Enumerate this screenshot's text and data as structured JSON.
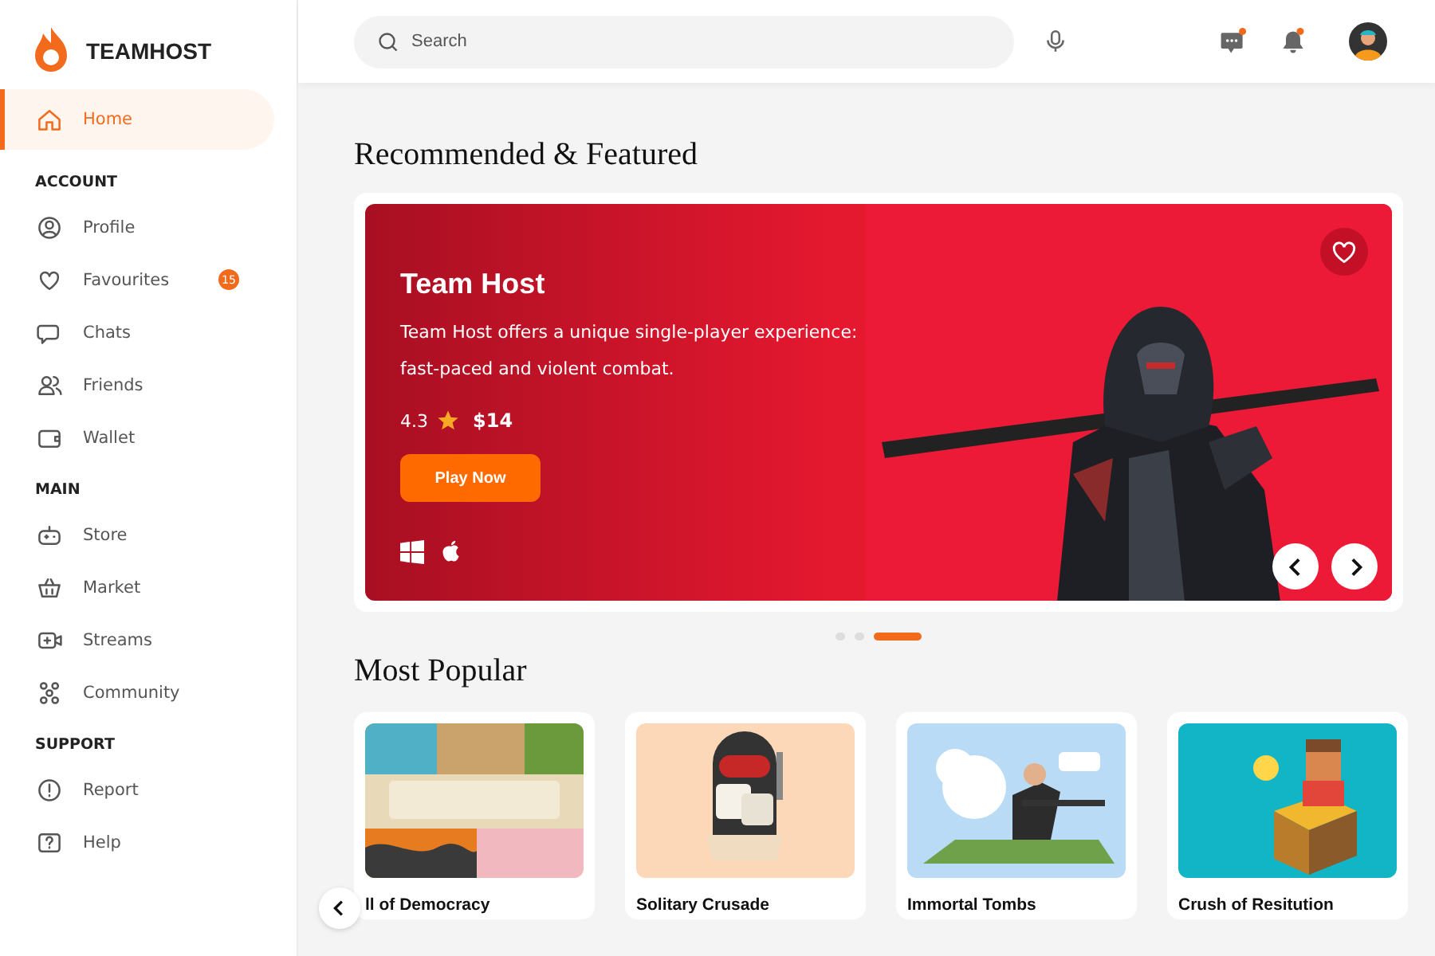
{
  "brand": {
    "name": "TEAMHOST"
  },
  "sidebar": {
    "sections": [
      {
        "items": [
          {
            "label": "Home",
            "selected": true
          }
        ]
      },
      {
        "heading": "ACCOUNT",
        "items": [
          {
            "label": "Profile",
            "selected": false
          },
          {
            "label": "Favourites",
            "selected": false,
            "badge": "15"
          },
          {
            "label": "Chats",
            "selected": false
          },
          {
            "label": "Friends",
            "selected": false
          },
          {
            "label": "Wallet",
            "selected": false
          }
        ]
      },
      {
        "heading": "MAIN",
        "items": [
          {
            "label": "Store",
            "selected": false
          },
          {
            "label": "Market",
            "selected": false
          },
          {
            "label": "Streams",
            "selected": false
          },
          {
            "label": "Community",
            "selected": false
          }
        ]
      },
      {
        "heading": "SUPPORT",
        "items": [
          {
            "label": "Report",
            "selected": false
          },
          {
            "label": "Help",
            "selected": false
          }
        ]
      }
    ]
  },
  "header": {
    "search": {
      "placeholder": "Search"
    },
    "notifications": {
      "messages_unread": true,
      "alerts_unread": true
    }
  },
  "featured": {
    "title": "Recommended & Featured",
    "game": {
      "name": "Team Host",
      "description": "Team Host offers a unique single-player experience: fast-paced and violent combat.",
      "rating": "4.3",
      "price": "$14",
      "button": "Play Now",
      "favourite": false
    },
    "dots": [
      {
        "selected": false
      },
      {
        "selected": false
      },
      {
        "selected": true
      }
    ]
  },
  "popular": {
    "title": "Most Popular",
    "cards": [
      {
        "title": "ll of Democracy",
        "kind": "picture"
      },
      {
        "title": "Solitary Crusade",
        "kind": "picture"
      },
      {
        "title": "Immortal Tombs",
        "kind": "picture"
      },
      {
        "title": "Crush of Resitution",
        "kind": "picture"
      }
    ]
  }
}
